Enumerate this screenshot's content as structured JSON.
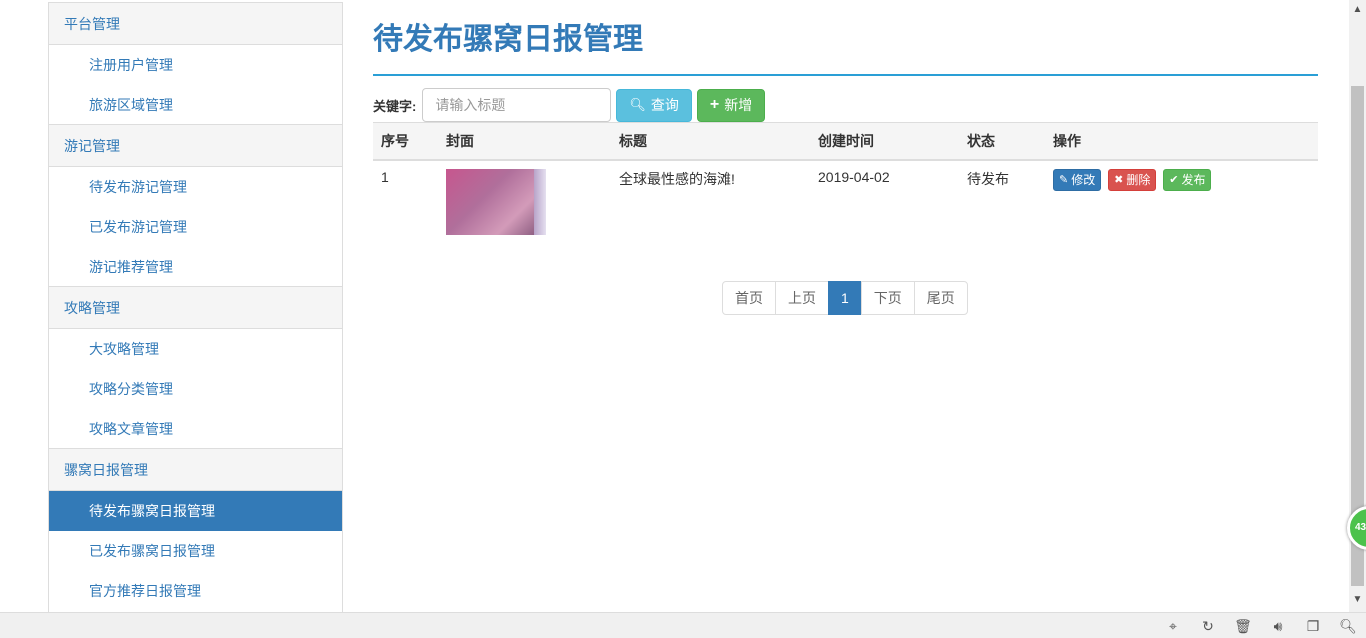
{
  "sidebar": {
    "groups": [
      {
        "header": "平台管理",
        "items": [
          "注册用户管理",
          "旅游区域管理"
        ]
      },
      {
        "header": "游记管理",
        "items": [
          "待发布游记管理",
          "已发布游记管理",
          "游记推荐管理"
        ]
      },
      {
        "header": "攻略管理",
        "items": [
          "大攻略管理",
          "攻略分类管理",
          "攻略文章管理"
        ]
      },
      {
        "header": "骡窝日报管理",
        "items": [
          "待发布骡窝日报管理",
          "已发布骡窝日报管理",
          "官方推荐日报管理"
        ]
      }
    ],
    "active_item": "待发布骡窝日报管理"
  },
  "main": {
    "title": "待发布骡窝日报管理",
    "search": {
      "label": "关键字:",
      "placeholder": "请输入标题",
      "value": ""
    },
    "buttons": {
      "query": "查询",
      "add": "新增"
    },
    "table": {
      "headers": [
        "序号",
        "封面",
        "标题",
        "创建时间",
        "状态",
        "操作"
      ],
      "rows": [
        {
          "index": "1",
          "title": "全球最性感的海滩!",
          "created": "2019-04-02",
          "status": "待发布",
          "actions": {
            "edit": "修改",
            "delete": "删除",
            "publish": "发布"
          }
        }
      ]
    },
    "pagination": {
      "first": "首页",
      "prev": "上页",
      "current": "1",
      "next": "下页",
      "last": "尾页"
    }
  },
  "float_ball": "43",
  "colors": {
    "primary": "#337ab7",
    "info": "#5bc0de",
    "success": "#5cb85c",
    "danger": "#d9534f",
    "rule": "#2a9fd6"
  }
}
